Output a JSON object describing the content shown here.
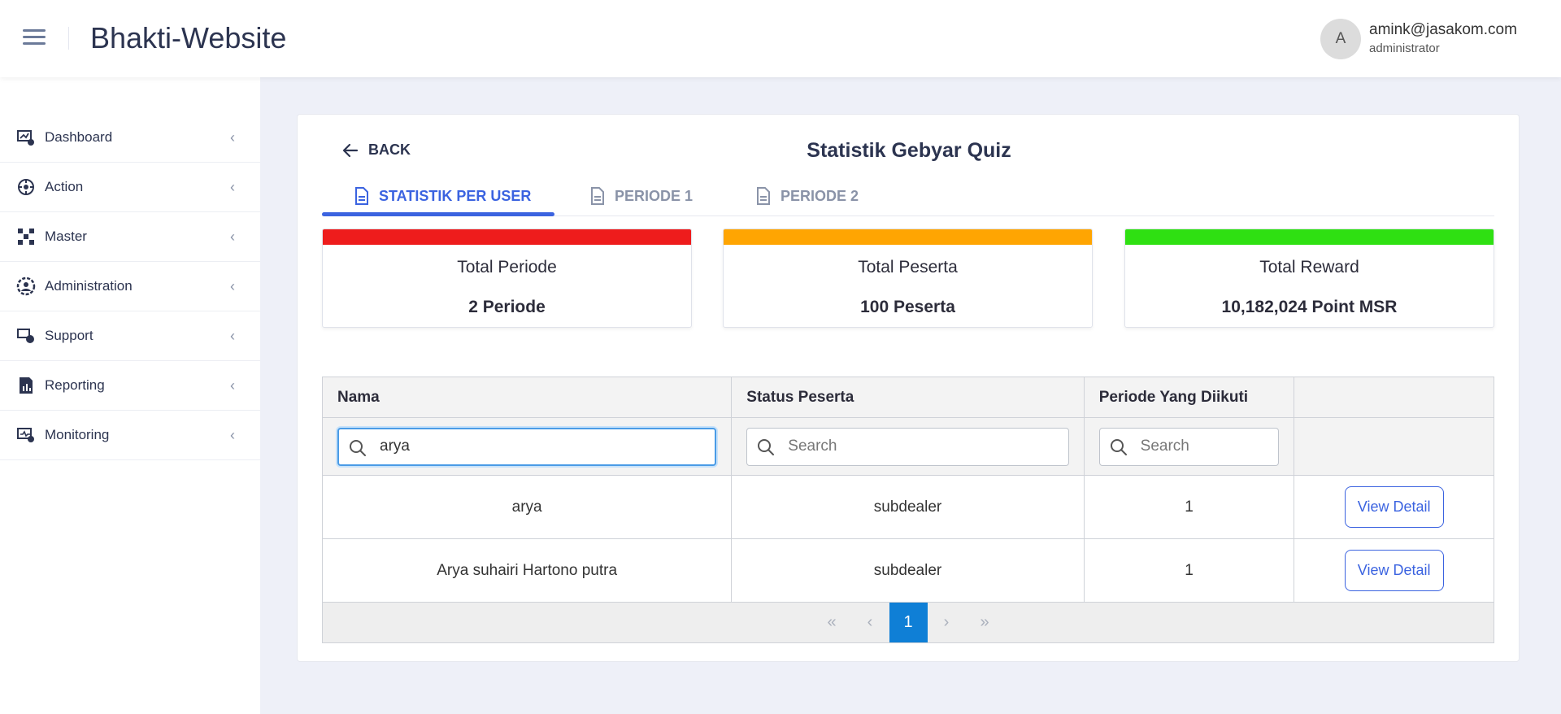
{
  "header": {
    "app_title": "Bhakti-Website",
    "avatar_initial": "A",
    "user_email": "amink@jasakom.com",
    "user_role": "administrator"
  },
  "sidebar": {
    "items": [
      {
        "label": "Dashboard",
        "icon": "dashboard-icon"
      },
      {
        "label": "Action",
        "icon": "action-icon"
      },
      {
        "label": "Master",
        "icon": "master-icon"
      },
      {
        "label": "Administration",
        "icon": "administration-icon"
      },
      {
        "label": "Support",
        "icon": "support-icon"
      },
      {
        "label": "Reporting",
        "icon": "reporting-icon"
      },
      {
        "label": "Monitoring",
        "icon": "monitoring-icon"
      }
    ]
  },
  "page": {
    "back_label": "BACK",
    "title": "Statistik Gebyar Quiz",
    "tabs": [
      {
        "label": "STATISTIK PER USER",
        "active": true
      },
      {
        "label": "PERIODE 1",
        "active": false
      },
      {
        "label": "PERIODE 2",
        "active": false
      }
    ]
  },
  "stats": [
    {
      "title": "Total Periode",
      "value": "2 Periode",
      "color": "#ee1c1c"
    },
    {
      "title": "Total Peserta",
      "value": "100 Peserta",
      "color": "#ffa502"
    },
    {
      "title": "Total Reward",
      "value": "10,182,024 Point MSR",
      "color": "#2fe012"
    }
  ],
  "table": {
    "columns": [
      "Nama",
      "Status Peserta",
      "Periode Yang Diikuti",
      ""
    ],
    "filters": {
      "nama_value": "arya",
      "status_placeholder": "Search",
      "periode_placeholder": "Search"
    },
    "rows": [
      {
        "nama": "arya",
        "status": "subdealer",
        "periode": "1",
        "action": "View Detail"
      },
      {
        "nama": "Arya suhairi Hartono putra",
        "status": "subdealer",
        "periode": "1",
        "action": "View Detail"
      }
    ],
    "pagination": {
      "first": "«",
      "prev": "‹",
      "current": "1",
      "next": "›",
      "last": "»"
    }
  },
  "colors": {
    "accent": "#3b63e0",
    "page_active": "#0f7fd6"
  }
}
